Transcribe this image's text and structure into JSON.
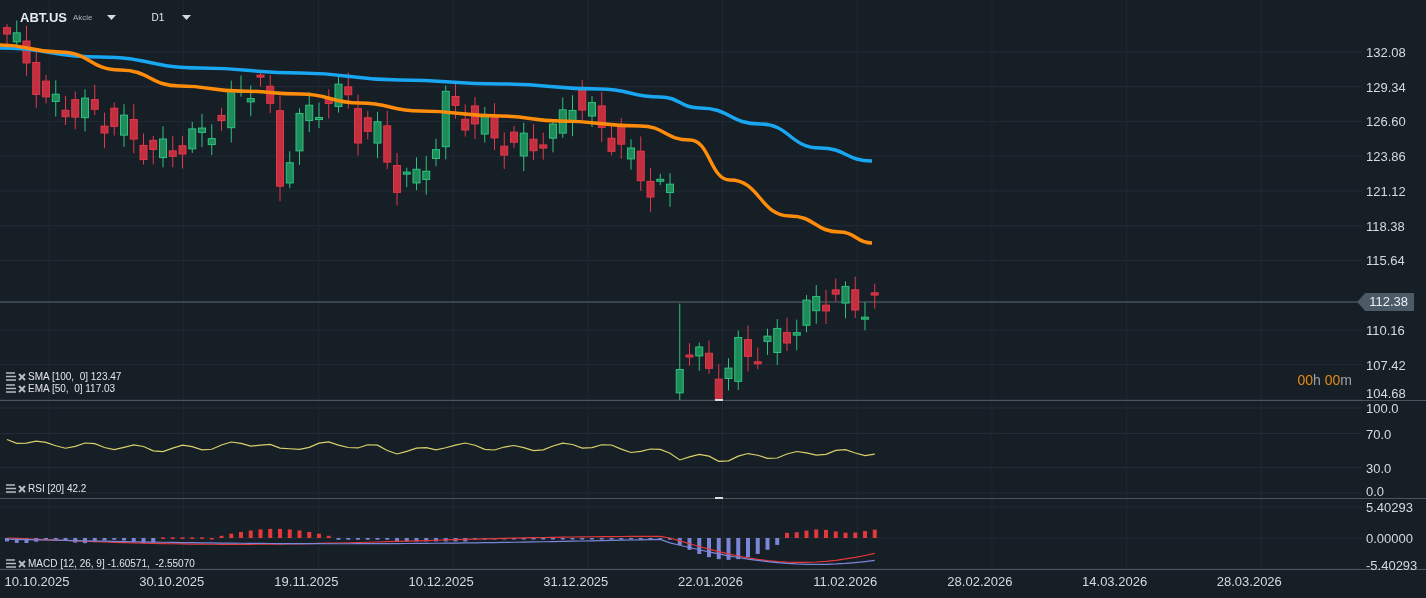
{
  "header": {
    "symbol": "ABT.US",
    "asset_type": "Akcie",
    "timeframe": "D1"
  },
  "price_pane": {
    "axis_labels": [
      "132.08",
      "129.34",
      "126.60",
      "123.86",
      "121.12",
      "118.38",
      "115.64",
      "110.16",
      "107.42",
      "104.68"
    ],
    "last_price": "112.38",
    "countdown": [
      {
        "text": "00",
        "kind": "digits"
      },
      {
        "text": "h",
        "kind": "unit"
      },
      {
        "text": "00",
        "kind": "digits"
      },
      {
        "text": "m",
        "kind": "unit"
      }
    ],
    "legend": [
      "SMA [100,  0] 123.47",
      "EMA [50,  0] 117.03"
    ]
  },
  "rsi_pane": {
    "axis_labels": [
      "100.0",
      "70.0",
      "30.0",
      "0.0"
    ],
    "legend": [
      "RSI [20] 42.2"
    ]
  },
  "macd_pane": {
    "axis_labels": [
      "5.40293",
      "0.00000",
      "-5.40293"
    ],
    "legend": [
      "MACD [12, 26, 9] -1.60571,  -2.55070"
    ]
  },
  "date_axis": [
    "10.10.2025",
    "30.10.2025",
    "19.11.2025",
    "10.12.2025",
    "31.12.2025",
    "22.01.2026",
    "11.02.2026",
    "28.02.2026",
    "14.03.2026",
    "28.03.2026"
  ]
}
